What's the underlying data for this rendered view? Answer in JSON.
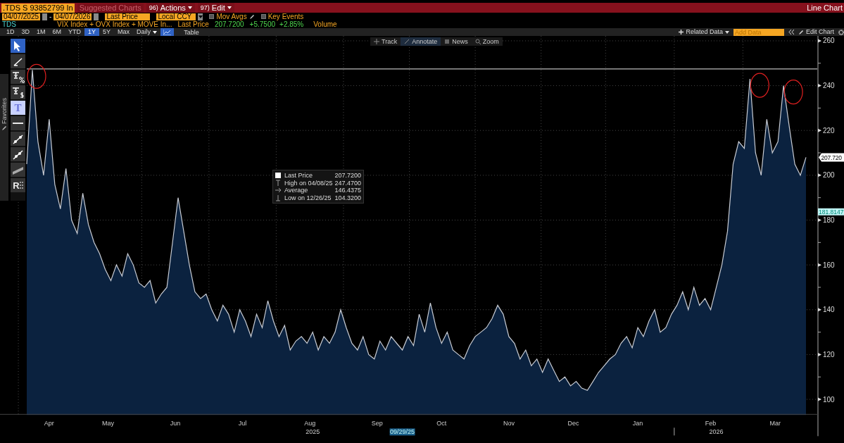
{
  "title_bar": {
    "security": ".TDS S 93852799 In",
    "suggested": {
      "label": "Suggested Charts",
      "disabled": true
    },
    "menus": [
      {
        "number": "96)",
        "label": "Actions"
      },
      {
        "number": "97)",
        "label": "Edit"
      }
    ],
    "title": "Line Chart"
  },
  "controls": {
    "start_date": "04/07/2025",
    "separator": "-",
    "end_date": "04/07/2026",
    "field": "Last Price",
    "currency": "Local CCY",
    "toggles": [
      {
        "label": "Mov Avgs",
        "checked": false,
        "kind": "pen"
      },
      {
        "label": "Key Events",
        "checked": false,
        "kind": "plain"
      }
    ]
  },
  "legend": {
    "comparison": "VIX Index + OVX Index + MOVE In...",
    "field": "Last Price",
    "price": "207.7200",
    "change": "+5.7500",
    "change_pct": "+2.85%",
    "volume": "Volume"
  },
  "periods": [
    {
      "label": "1D",
      "selected": false
    },
    {
      "label": "3D",
      "selected": false
    },
    {
      "label": "1M",
      "selected": false
    },
    {
      "label": "6M",
      "selected": false
    },
    {
      "label": "YTD",
      "selected": false
    },
    {
      "label": "1Y",
      "selected": true
    },
    {
      "label": "5Y",
      "selected": false
    },
    {
      "label": "Max",
      "selected": false
    }
  ],
  "frequency": "Daily",
  "views": [
    {
      "kind": "chart",
      "selected": true
    },
    {
      "kind": "table",
      "label": "Table",
      "selected": false
    }
  ],
  "right_actions": {
    "related": "Related Data",
    "add_data_placeholder": "Add Data",
    "edit": "Edit Chart"
  },
  "chart_tools": [
    {
      "label": "Track",
      "kind": "track",
      "selected": false
    },
    {
      "label": "Annotate",
      "kind": "annotate",
      "selected": true
    },
    {
      "label": "News",
      "kind": "news",
      "selected": false
    },
    {
      "label": "Zoom",
      "kind": "zoom",
      "selected": false
    }
  ],
  "favorites_label": "Favorites",
  "drawing_tools": [
    {
      "kind": "pointer",
      "selected": true
    },
    {
      "kind": "pen",
      "selected": false
    },
    {
      "kind": "pct",
      "selected": false
    },
    {
      "kind": "dollar",
      "selected": false
    },
    {
      "kind": "text",
      "label": "T",
      "selected": true
    },
    {
      "kind": "hline",
      "selected": false
    },
    {
      "kind": "trend",
      "selected": false
    },
    {
      "kind": "trend2",
      "selected": false
    },
    {
      "kind": "channel",
      "selected": false
    },
    {
      "kind": "regression",
      "label": "R",
      "selected": false
    }
  ],
  "tooltip": [
    {
      "kind": "last",
      "label": "Last Price",
      "value": "207.7200"
    },
    {
      "kind": "high",
      "label": "High on 04/08/25",
      "value": "247.4700"
    },
    {
      "kind": "avg",
      "label": "Average",
      "value": "146.4375"
    },
    {
      "kind": "low",
      "label": "Low on 12/26/25",
      "value": "104.3200"
    }
  ],
  "price_markers": [
    {
      "kind": "last",
      "label": "207.720"
    },
    {
      "kind": "cursor",
      "label": "181.8147"
    }
  ],
  "month_labels": [
    "Apr",
    "May",
    "Jun",
    "Jul",
    "Aug",
    "Sep",
    "Oct",
    "Nov",
    "Dec",
    "Jan",
    "Feb",
    "Mar"
  ],
  "year_labels": [
    "2025",
    "2026"
  ],
  "cursor_date": "09/29/25",
  "chart_data": {
    "type": "area",
    "ylim": [
      93,
      262
    ],
    "yticks": [
      100,
      120,
      140,
      160,
      180,
      200,
      220,
      240,
      260
    ],
    "grid": true,
    "ref_lines": [
      {
        "axis": "y",
        "value": 247.47
      }
    ],
    "series": [
      {
        "name": "TDS",
        "color": "#c8ccd4",
        "values": [
          205,
          247,
          215,
          200,
          225,
          196,
          185,
          203,
          180,
          174,
          192,
          178,
          170,
          165,
          158,
          153,
          160,
          155,
          165,
          160,
          152,
          150,
          153,
          143,
          147,
          150,
          170,
          190,
          175,
          160,
          148,
          145,
          147,
          140,
          135,
          142,
          138,
          130,
          140,
          135,
          128,
          138,
          132,
          144,
          135,
          128,
          133,
          122,
          126,
          128,
          125,
          130,
          122,
          128,
          125,
          130,
          140,
          132,
          125,
          122,
          128,
          120,
          118,
          126,
          122,
          128,
          125,
          122,
          128,
          124,
          138,
          130,
          143,
          132,
          125,
          130,
          122,
          120,
          118,
          124,
          128,
          130,
          132,
          136,
          142,
          138,
          128,
          125,
          118,
          122,
          115,
          118,
          112,
          118,
          113,
          108,
          110,
          106,
          108,
          105,
          104,
          108,
          112,
          115,
          118,
          120,
          125,
          128,
          123,
          132,
          128,
          135,
          140,
          130,
          132,
          138,
          142,
          148,
          140,
          150,
          142,
          145,
          140,
          150,
          160,
          175,
          205,
          215,
          212,
          243,
          210,
          200,
          225,
          210,
          215,
          240,
          222,
          205,
          200,
          208
        ]
      }
    ]
  }
}
